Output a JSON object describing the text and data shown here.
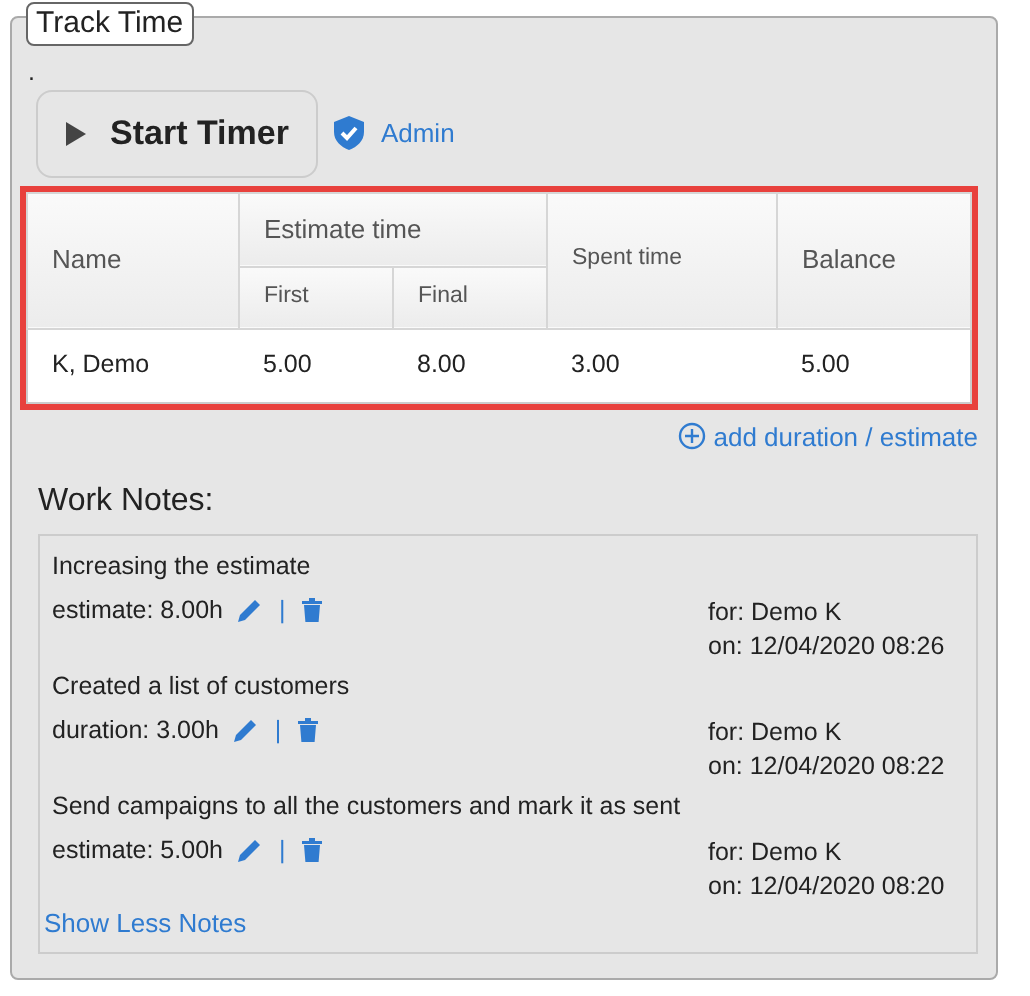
{
  "legend": "Track Time",
  "marker": ".",
  "start_button": {
    "label": "Start Timer"
  },
  "role_link": "Admin",
  "table": {
    "highlighted": true,
    "group_header": {
      "label": "Estimate time",
      "sub": [
        "First",
        "Final"
      ]
    },
    "name_header": "Name",
    "spent_header": "Spent time",
    "balance_header": "Balance",
    "rows": [
      [
        "K, Demo",
        "5.00",
        "8.00",
        "3.00",
        "5.00"
      ]
    ]
  },
  "add_link": "add duration / estimate",
  "notes_title": "Work Notes:",
  "notes": [
    {
      "text": "Increasing the estimate",
      "detail": "estimate: 8.00h",
      "separator": "|",
      "for": "for: Demo K",
      "on": "on: 12/04/2020 08:26"
    },
    {
      "text": "Created a list of customers",
      "detail": "duration: 3.00h",
      "separator": "|",
      "for": "for: Demo K",
      "on": "on: 12/04/2020 08:22"
    },
    {
      "text": "Send campaigns to all the customers and mark it as sent",
      "detail": "estimate: 5.00h",
      "separator": "|",
      "for": "for: Demo K",
      "on": "on: 12/04/2020 08:20"
    }
  ],
  "toggle_link": "Show Less Notes"
}
